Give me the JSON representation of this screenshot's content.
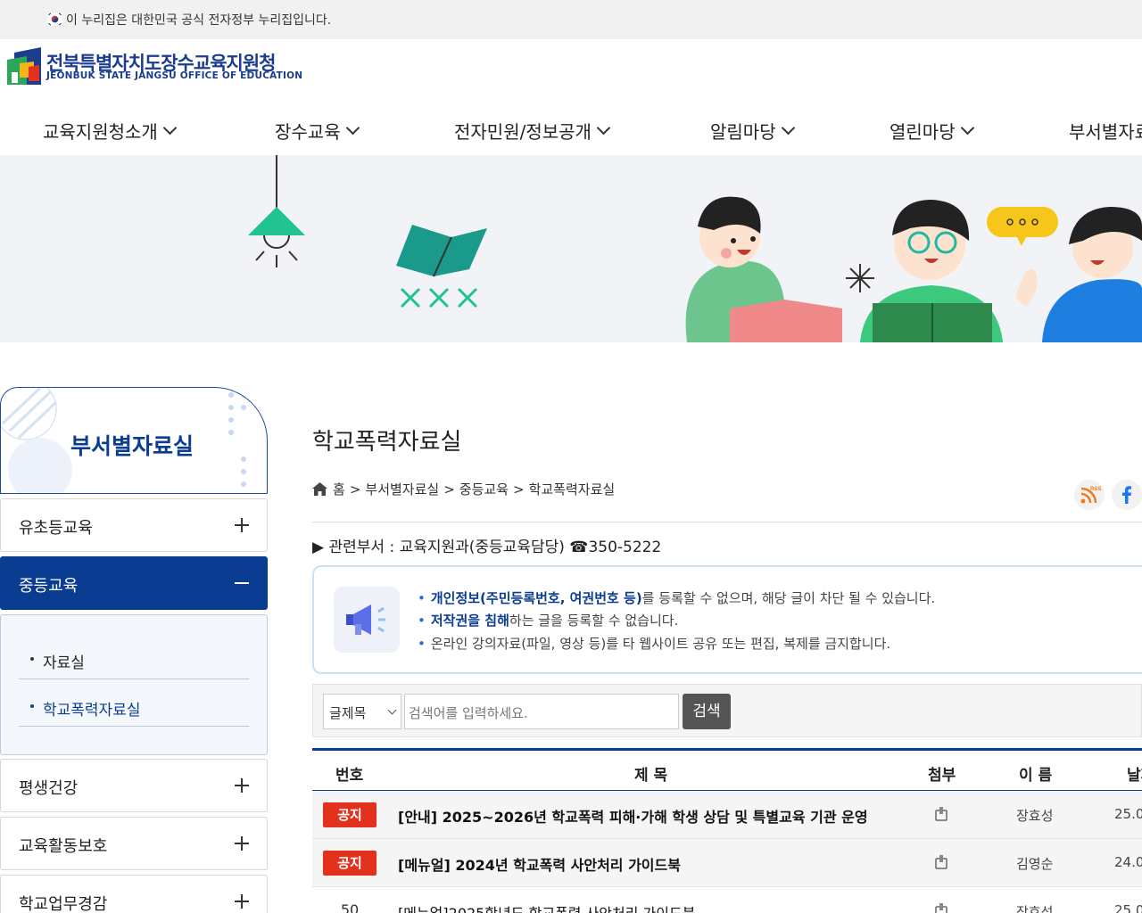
{
  "gov_bar": {
    "text": "이 누리집은 대한민국 공식 전자정부 누리집입니다."
  },
  "header": {
    "logo_title": "전북특별자치도장수교육지원청",
    "logo_sub": "JEONBUK STATE JANGSU OFFICE OF EDUCATION"
  },
  "gnb": [
    {
      "label": "교육지원청소개"
    },
    {
      "label": "장수교육"
    },
    {
      "label": "전자민원/정보공개"
    },
    {
      "label": "알림마당"
    },
    {
      "label": "열린마당"
    },
    {
      "label": "부서별자료실"
    }
  ],
  "lnb": {
    "title": "부서별자료실",
    "items": [
      {
        "label": "유초등교육"
      },
      {
        "label": "중등교육"
      },
      {
        "label": "평생건강"
      },
      {
        "label": "교육활동보호"
      },
      {
        "label": "학교업무경감"
      }
    ],
    "sub_items": [
      {
        "label": "자료실"
      },
      {
        "label": "학교폭력자료실"
      }
    ]
  },
  "content": {
    "title": "학교폭력자료실",
    "breadcrumb": [
      "홈",
      ">",
      "부서별자료실",
      ">",
      "중등교육",
      ">",
      "학교폭력자료실"
    ],
    "rss_label": "RSS",
    "dept": "▶ 관련부서 : 교육지원과(중등교육담당) ☎350-5222",
    "notices": [
      {
        "bold": "개인정보(주민등록번호, 여권번호 등)",
        "rest": "를 등록할 수 없으며, 해당 글이 차단 될 수 있습니다."
      },
      {
        "bold": "저작권을 침해",
        "rest": "하는 글을 등록할 수 없습니다."
      },
      {
        "bold": "",
        "rest": "온라인 강의자료(파일, 영상 등)를 타 웹사이트 공유 또는 편집, 복제를 금지합니다."
      }
    ]
  },
  "search": {
    "select_value": "글제목",
    "placeholder": "검색어를 입력하세요.",
    "button": "검색"
  },
  "table": {
    "headers": {
      "num": "번호",
      "subject": "제 목",
      "attach": "첨부",
      "author": "이 름",
      "date": "날짜"
    },
    "rows": [
      {
        "num": "공지",
        "subject": "[안내] 2025~2026년 학교폭력 피해·가해 학생 상담 및 특별교육 기관 운영",
        "author": "장효성",
        "date": "25.0",
        "is_notice": true
      },
      {
        "num": "공지",
        "subject": "[메뉴얼] 2024년 학교폭력 사안처리 가이드북",
        "author": "김영순",
        "date": "24.0",
        "is_notice": true
      },
      {
        "num": "50",
        "subject": "[메뉴얼]2025학년도 학교폭력 사안처리 가이드북",
        "author": "장효성",
        "date": "25.0",
        "is_notice": false
      }
    ]
  },
  "colors": {
    "brand": "#0a3d91",
    "notice_badge": "#e2311d",
    "banner_bg": "#f2f3f6"
  }
}
